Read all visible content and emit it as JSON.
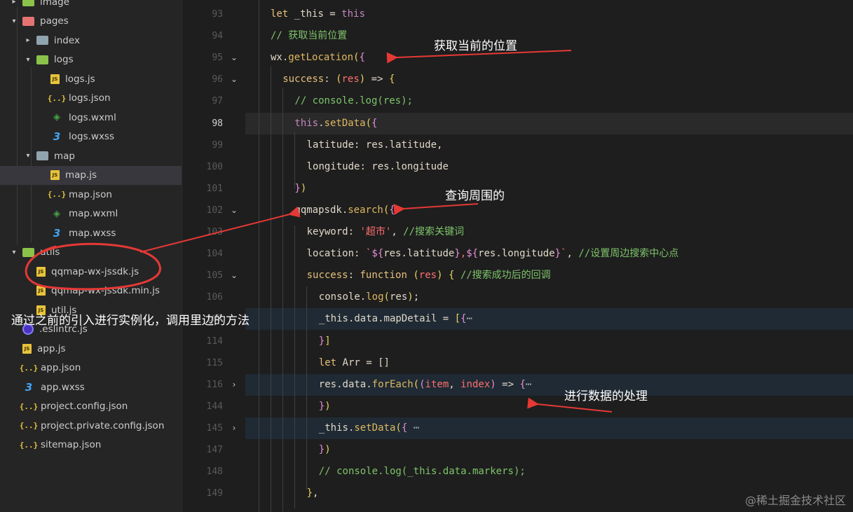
{
  "explorer": {
    "items": [
      {
        "label": "image",
        "type": "folder-green",
        "twisty": "▸",
        "indent": 1
      },
      {
        "label": "pages",
        "type": "folder-red",
        "twisty": "▾",
        "indent": 1
      },
      {
        "label": "index",
        "type": "folder-gray",
        "twisty": "▸",
        "indent": 2
      },
      {
        "label": "logs",
        "type": "folder-green",
        "twisty": "▾",
        "indent": 2
      },
      {
        "label": "logs.js",
        "type": "js",
        "twisty": "",
        "indent": 3
      },
      {
        "label": "logs.json",
        "type": "json",
        "twisty": "",
        "indent": 3
      },
      {
        "label": "logs.wxml",
        "type": "wxml",
        "twisty": "",
        "indent": 3
      },
      {
        "label": "logs.wxss",
        "type": "wxss",
        "twisty": "",
        "indent": 3
      },
      {
        "label": "map",
        "type": "folder-gray",
        "twisty": "▾",
        "indent": 2
      },
      {
        "label": "map.js",
        "type": "js",
        "twisty": "",
        "indent": 3,
        "selected": true
      },
      {
        "label": "map.json",
        "type": "json",
        "twisty": "",
        "indent": 3
      },
      {
        "label": "map.wxml",
        "type": "wxml",
        "twisty": "",
        "indent": 3
      },
      {
        "label": "map.wxss",
        "type": "wxss",
        "twisty": "",
        "indent": 3
      },
      {
        "label": "utils",
        "type": "folder-green",
        "twisty": "▾",
        "indent": 1
      },
      {
        "label": "qqmap-wx-jssdk.js",
        "type": "js",
        "twisty": "",
        "indent": 2
      },
      {
        "label": "qqmap-wx-jssdk.min.js",
        "type": "js",
        "twisty": "",
        "indent": 2
      },
      {
        "label": "util.js",
        "type": "js",
        "twisty": "",
        "indent": 2
      },
      {
        "label": ".eslintrc.js",
        "type": "eslint",
        "twisty": "",
        "indent": 1
      },
      {
        "label": "app.js",
        "type": "js",
        "twisty": "",
        "indent": 1
      },
      {
        "label": "app.json",
        "type": "json",
        "twisty": "",
        "indent": 1
      },
      {
        "label": "app.wxss",
        "type": "wxss",
        "twisty": "",
        "indent": 1
      },
      {
        "label": "project.config.json",
        "type": "json",
        "twisty": "",
        "indent": 1
      },
      {
        "label": "project.private.config.json",
        "type": "json",
        "twisty": "",
        "indent": 1
      },
      {
        "label": "sitemap.json",
        "type": "json",
        "twisty": "",
        "indent": 1
      }
    ]
  },
  "editor": {
    "active_line": "98",
    "lines": [
      {
        "n": "93",
        "fold": "",
        "indent": 2,
        "tokens": [
          [
            "k",
            "let"
          ],
          [
            "v",
            " _this = "
          ],
          [
            "kw",
            "this"
          ]
        ]
      },
      {
        "n": "94",
        "fold": "",
        "indent": 2,
        "tokens": [
          [
            "c",
            "// 获取当前位置"
          ]
        ]
      },
      {
        "n": "95",
        "fold": "⌄",
        "indent": 2,
        "tokens": [
          [
            "v",
            "wx."
          ],
          [
            "fn",
            "getLocation"
          ],
          [
            "p",
            "("
          ],
          [
            "tp",
            "{"
          ]
        ]
      },
      {
        "n": "96",
        "fold": "⌄",
        "indent": 3,
        "tokens": [
          [
            "k",
            "success"
          ],
          [
            "v",
            ": "
          ],
          [
            "p",
            "("
          ],
          [
            "s",
            "res"
          ],
          [
            "p",
            ")"
          ],
          [
            "v",
            " => "
          ],
          [
            "p",
            "{"
          ]
        ]
      },
      {
        "n": "97",
        "fold": "",
        "indent": 4,
        "tokens": [
          [
            "c",
            "// console.log(res);"
          ]
        ]
      },
      {
        "n": "98",
        "fold": "",
        "indent": 4,
        "hl": "line",
        "tokens": [
          [
            "kw",
            "this"
          ],
          [
            "v",
            "."
          ],
          [
            "fn",
            "setData"
          ],
          [
            "p",
            "("
          ],
          [
            "tp",
            "{"
          ]
        ]
      },
      {
        "n": "99",
        "fold": "",
        "indent": 5,
        "tokens": [
          [
            "v",
            "latitude: res.latitude,"
          ]
        ]
      },
      {
        "n": "100",
        "fold": "",
        "indent": 5,
        "tokens": [
          [
            "v",
            "longitude: res.longitude"
          ]
        ]
      },
      {
        "n": "101",
        "fold": "",
        "indent": 4,
        "tokens": [
          [
            "tp",
            "}"
          ],
          [
            "p",
            ")"
          ]
        ]
      },
      {
        "n": "102",
        "fold": "⌄",
        "indent": 4,
        "tokens": [
          [
            "v",
            "qqmapsdk."
          ],
          [
            "fn",
            "search"
          ],
          [
            "p",
            "("
          ],
          [
            "tp",
            "{"
          ]
        ]
      },
      {
        "n": "103",
        "fold": "",
        "indent": 5,
        "tokens": [
          [
            "v",
            "keyword: "
          ],
          [
            "s",
            "'超市'"
          ],
          [
            "v",
            ", "
          ],
          [
            "c",
            "//搜索关键词"
          ]
        ]
      },
      {
        "n": "104",
        "fold": "",
        "indent": 5,
        "tokens": [
          [
            "v",
            "location: "
          ],
          [
            "s",
            "`"
          ],
          [
            "tp",
            "${"
          ],
          [
            "v",
            "res.latitude"
          ],
          [
            "tp",
            "}"
          ],
          [
            "s",
            ","
          ],
          [
            "tp",
            "${"
          ],
          [
            "v",
            "res.longitude"
          ],
          [
            "tp",
            "}"
          ],
          [
            "s",
            "`"
          ],
          [
            "v",
            ", "
          ],
          [
            "c",
            "//设置周边搜索中心点"
          ]
        ]
      },
      {
        "n": "105",
        "fold": "⌄",
        "indent": 5,
        "tokens": [
          [
            "k",
            "success"
          ],
          [
            "v",
            ": "
          ],
          [
            "k",
            "function"
          ],
          [
            "v",
            " "
          ],
          [
            "p",
            "("
          ],
          [
            "s",
            "res"
          ],
          [
            "p",
            ")"
          ],
          [
            "v",
            " "
          ],
          [
            "p",
            "{"
          ],
          [
            "v",
            " "
          ],
          [
            "c",
            "//搜索成功后的回调"
          ]
        ]
      },
      {
        "n": "106",
        "fold": "",
        "indent": 6,
        "tokens": [
          [
            "v",
            "console."
          ],
          [
            "fn",
            "log"
          ],
          [
            "p",
            "("
          ],
          [
            "v",
            "res"
          ],
          [
            "p",
            ")"
          ],
          [
            "v",
            ";"
          ]
        ]
      },
      {
        "n": "107",
        "fold": "",
        "indent": 6,
        "hl": "fold",
        "tokens": [
          [
            "v",
            "_this.data.mapDetail = "
          ],
          [
            "p",
            "["
          ],
          [
            "tp",
            "{"
          ],
          [
            "ph",
            "⋯"
          ]
        ]
      },
      {
        "n": "114",
        "fold": "",
        "indent": 6,
        "tokens": [
          [
            "tp",
            "}"
          ],
          [
            "p",
            "]"
          ]
        ]
      },
      {
        "n": "115",
        "fold": "",
        "indent": 6,
        "tokens": [
          [
            "k",
            "let"
          ],
          [
            "v",
            " Arr = []"
          ]
        ]
      },
      {
        "n": "116",
        "fold": "›",
        "indent": 6,
        "hl": "fold",
        "tokens": [
          [
            "v",
            "res.data."
          ],
          [
            "fn",
            "forEach"
          ],
          [
            "p",
            "("
          ],
          [
            "tp",
            "("
          ],
          [
            "s",
            "item"
          ],
          [
            "v",
            ", "
          ],
          [
            "s",
            "index"
          ],
          [
            "tp",
            ")"
          ],
          [
            "v",
            " => "
          ],
          [
            "tp",
            "{"
          ],
          [
            "ph",
            "⋯"
          ]
        ]
      },
      {
        "n": "144",
        "fold": "",
        "indent": 6,
        "tokens": [
          [
            "tp",
            "}"
          ],
          [
            "p",
            ")"
          ]
        ]
      },
      {
        "n": "145",
        "fold": "›",
        "indent": 6,
        "hl": "fold",
        "tokens": [
          [
            "v",
            "_this."
          ],
          [
            "fn",
            "setData"
          ],
          [
            "p",
            "("
          ],
          [
            "tp",
            "{"
          ],
          [
            "ph",
            " ⋯"
          ]
        ]
      },
      {
        "n": "147",
        "fold": "",
        "indent": 6,
        "tokens": [
          [
            "tp",
            "}"
          ],
          [
            "p",
            ")"
          ]
        ]
      },
      {
        "n": "148",
        "fold": "",
        "indent": 6,
        "tokens": [
          [
            "c",
            "// console.log(_this.data.markers);"
          ]
        ]
      },
      {
        "n": "149",
        "fold": "",
        "indent": 5,
        "tokens": [
          [
            "p",
            "}"
          ],
          [
            "v",
            ","
          ]
        ]
      }
    ]
  },
  "annotations": {
    "get_location": "获取当前的位置",
    "search_around": "查询周围的",
    "instantiate": "通过之前的引入进行实例化，调用里边的方法",
    "process_data": "进行数据的处理",
    "color": "#e53935"
  },
  "watermark": "@稀土掘金技术社区"
}
